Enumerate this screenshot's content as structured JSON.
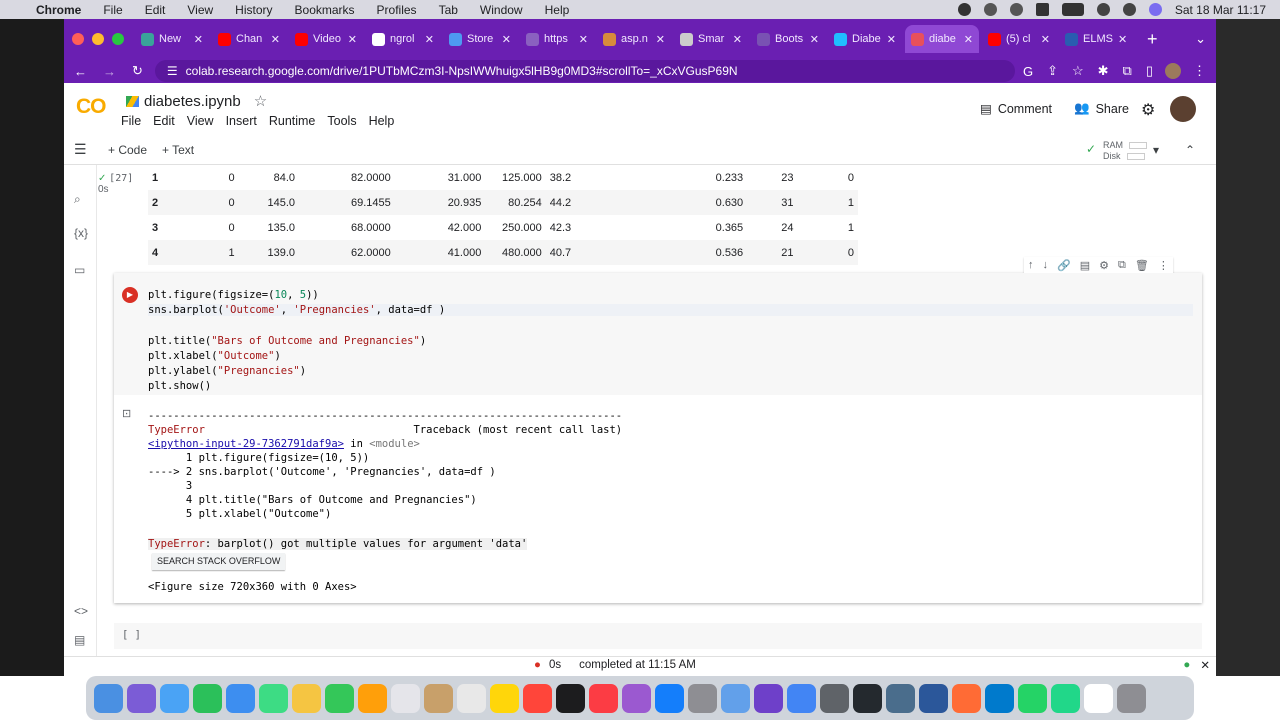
{
  "menubar": {
    "app": "Chrome",
    "items": [
      "File",
      "Edit",
      "View",
      "History",
      "Bookmarks",
      "Profiles",
      "Tab",
      "Window",
      "Help"
    ],
    "datetime": "Sat 18 Mar  11:17"
  },
  "tabs": [
    {
      "label": "New",
      "color": "#3aa39a"
    },
    {
      "label": "Chan",
      "color": "#ff0000"
    },
    {
      "label": "Video",
      "color": "#ff0000"
    },
    {
      "label": "ngrol",
      "color": "#ffffff"
    },
    {
      "label": "Store",
      "color": "#4e9af1"
    },
    {
      "label": "https",
      "color": "#8a60c0"
    },
    {
      "label": "asp.n",
      "color": "#d78b3b"
    },
    {
      "label": "Smar",
      "color": "#cccccc"
    },
    {
      "label": "Boots",
      "color": "#7952b3"
    },
    {
      "label": "Diabe",
      "color": "#20beff"
    },
    {
      "label": "diabe",
      "color": "#e8505b",
      "active": true
    },
    {
      "label": "(5) cl",
      "color": "#ff0000"
    },
    {
      "label": "ELMS",
      "color": "#2a5cb0"
    }
  ],
  "url": "colab.research.google.com/drive/1PUTbMCzm3I-NpsIWWhuigx5lHB9g0MD3#scrollTo=_xCxVGusP69N",
  "notebook": {
    "logo": "CO",
    "filename": "diabetes.ipynb",
    "menus": [
      "File",
      "Edit",
      "View",
      "Insert",
      "Runtime",
      "Tools",
      "Help"
    ],
    "comment": "Comment",
    "share": "Share"
  },
  "toolbar": {
    "code": "+ Code",
    "text": "+ Text",
    "ram": "RAM",
    "disk": "Disk"
  },
  "prev_cell": {
    "exec": "[27]",
    "time": "0s",
    "rows": [
      [
        "1",
        "0",
        "84.0",
        "82.0000",
        "31.000",
        "125.000",
        "38.2",
        "0.233",
        "23",
        "0"
      ],
      [
        "2",
        "0",
        "145.0",
        "69.1455",
        "20.935",
        "80.254",
        "44.2",
        "0.630",
        "31",
        "1"
      ],
      [
        "3",
        "0",
        "135.0",
        "68.0000",
        "42.000",
        "250.000",
        "42.3",
        "0.365",
        "24",
        "1"
      ],
      [
        "4",
        "1",
        "139.0",
        "62.0000",
        "41.000",
        "480.000",
        "40.7",
        "0.536",
        "21",
        "0"
      ]
    ]
  },
  "status": {
    "time": "0s",
    "text": "completed at 11:15 AM"
  }
}
